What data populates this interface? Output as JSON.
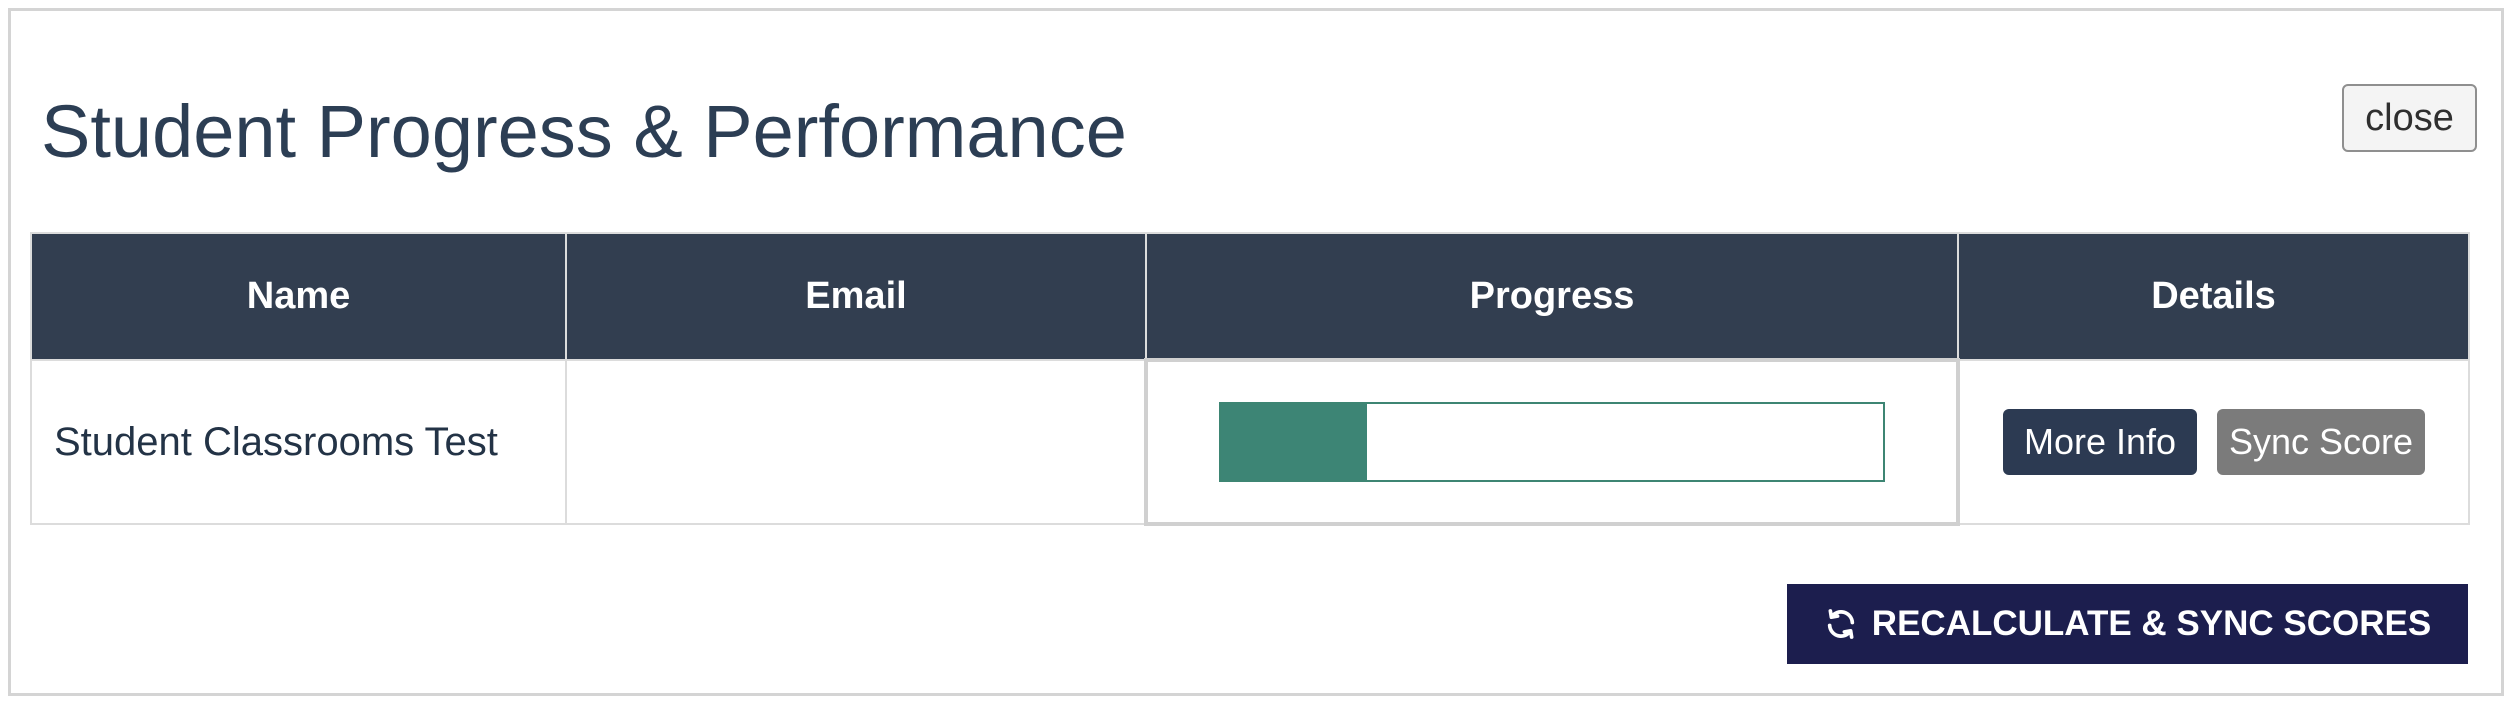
{
  "modal": {
    "title": "Student Progress & Performance",
    "close_label": "close"
  },
  "table": {
    "headers": [
      "Name",
      "Email",
      "Progress",
      "Details"
    ],
    "rows": [
      {
        "name": "Student Classrooms Test",
        "email": "",
        "progress_fraction": 0.22,
        "more_info_label": "More Info",
        "sync_score_label": "Sync Score"
      }
    ]
  },
  "footer": {
    "recalculate_label": "RECALCULATE & SYNC SCORES",
    "recalculate_icon": "sync-icon"
  },
  "colors": {
    "header_bg": "#323e50",
    "progress_fill": "#3d8575",
    "recalculate_bg": "#1c1e4e",
    "more_info_bg": "#2c3a52",
    "sync_score_bg": "#7b7b7b"
  }
}
